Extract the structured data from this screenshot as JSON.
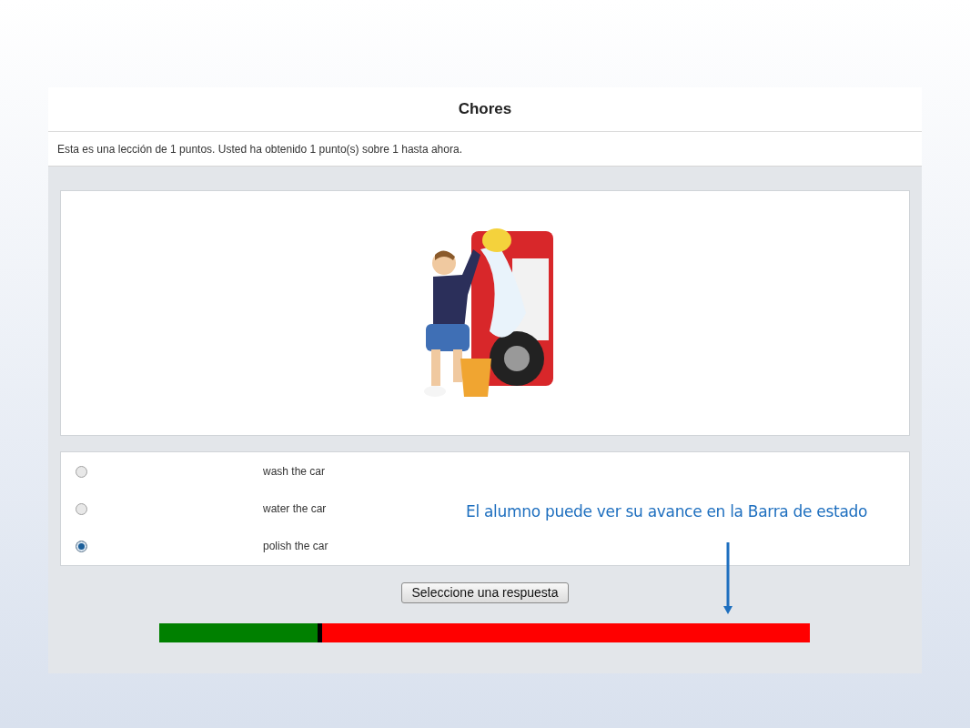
{
  "lesson": {
    "title": "Chores",
    "info": "Esta es una lección de 1 puntos. Usted ha obtenido 1 punto(s) sobre 1 hasta ahora.",
    "options": [
      {
        "label": "wash the car",
        "selected": false
      },
      {
        "label": "water the car",
        "selected": false
      },
      {
        "label": "polish the car",
        "selected": true
      }
    ],
    "submit_button": "Seleccione una respuesta",
    "progress": {
      "level": 0.25
    }
  },
  "annotation": {
    "text": "El alumno puede ver su avance en la Barra de estado"
  }
}
